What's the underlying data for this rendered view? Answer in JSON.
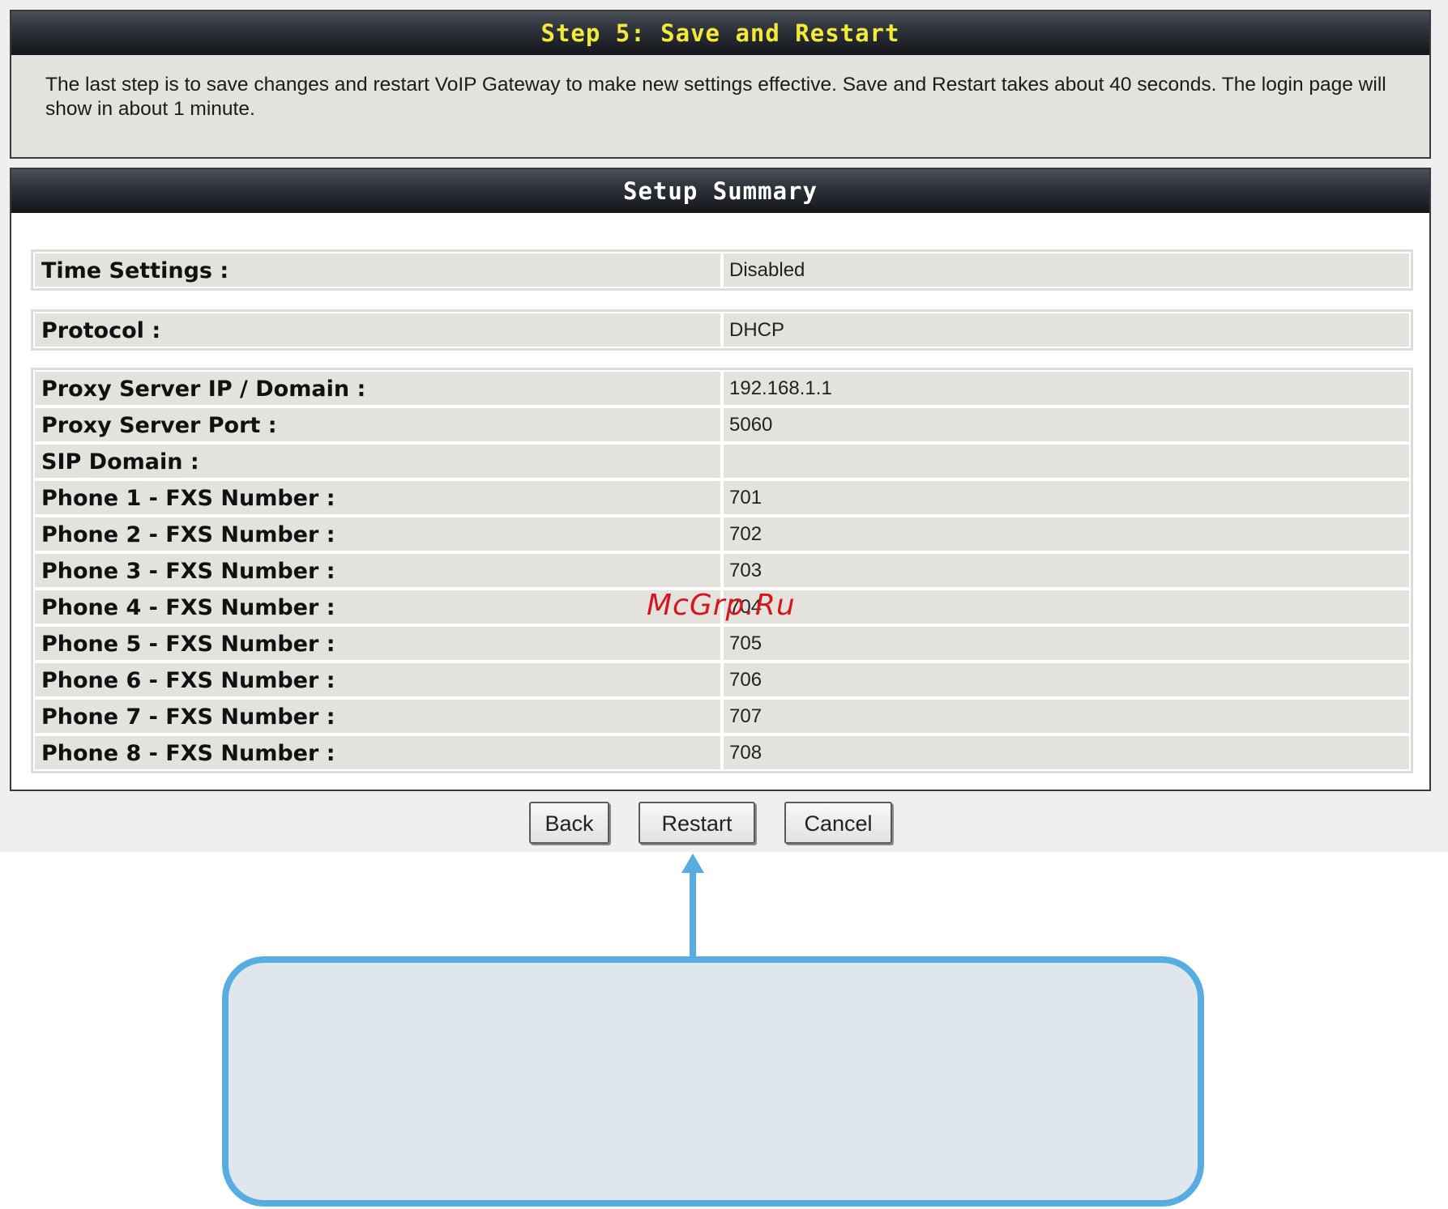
{
  "step": {
    "title": "Step 5: Save and Restart",
    "description": "The last step is to save changes and restart VoIP Gateway to make new settings effective. Save and Restart takes about 40 seconds. The login page will show in about 1 minute."
  },
  "summary": {
    "title": "Setup Summary",
    "time_settings": {
      "label": "Time Settings :",
      "value": "Disabled"
    },
    "protocol": {
      "label": "Protocol :",
      "value": "DHCP"
    },
    "sip": [
      {
        "label": "Proxy Server IP / Domain :",
        "value": "192.168.1.1"
      },
      {
        "label": "Proxy Server Port :",
        "value": "5060"
      },
      {
        "label": "SIP Domain :",
        "value": ""
      },
      {
        "label": "Phone 1 - FXS Number :",
        "value": "701"
      },
      {
        "label": "Phone 2 - FXS Number :",
        "value": "702"
      },
      {
        "label": "Phone 3 - FXS Number :",
        "value": "703"
      },
      {
        "label": "Phone 4 - FXS Number :",
        "value": "704"
      },
      {
        "label": "Phone 5 - FXS Number :",
        "value": "705"
      },
      {
        "label": "Phone 6 - FXS Number :",
        "value": "706"
      },
      {
        "label": "Phone 7 - FXS Number :",
        "value": "707"
      },
      {
        "label": "Phone 8 - FXS Number :",
        "value": "708"
      }
    ]
  },
  "buttons": {
    "back": "Back",
    "restart": "Restart",
    "cancel": "Cancel"
  },
  "watermark": "McGrp.Ru",
  "colors": {
    "header_title": "#f3e93a",
    "callout_border": "#57ade2",
    "callout_fill": "#dfe6ec"
  }
}
